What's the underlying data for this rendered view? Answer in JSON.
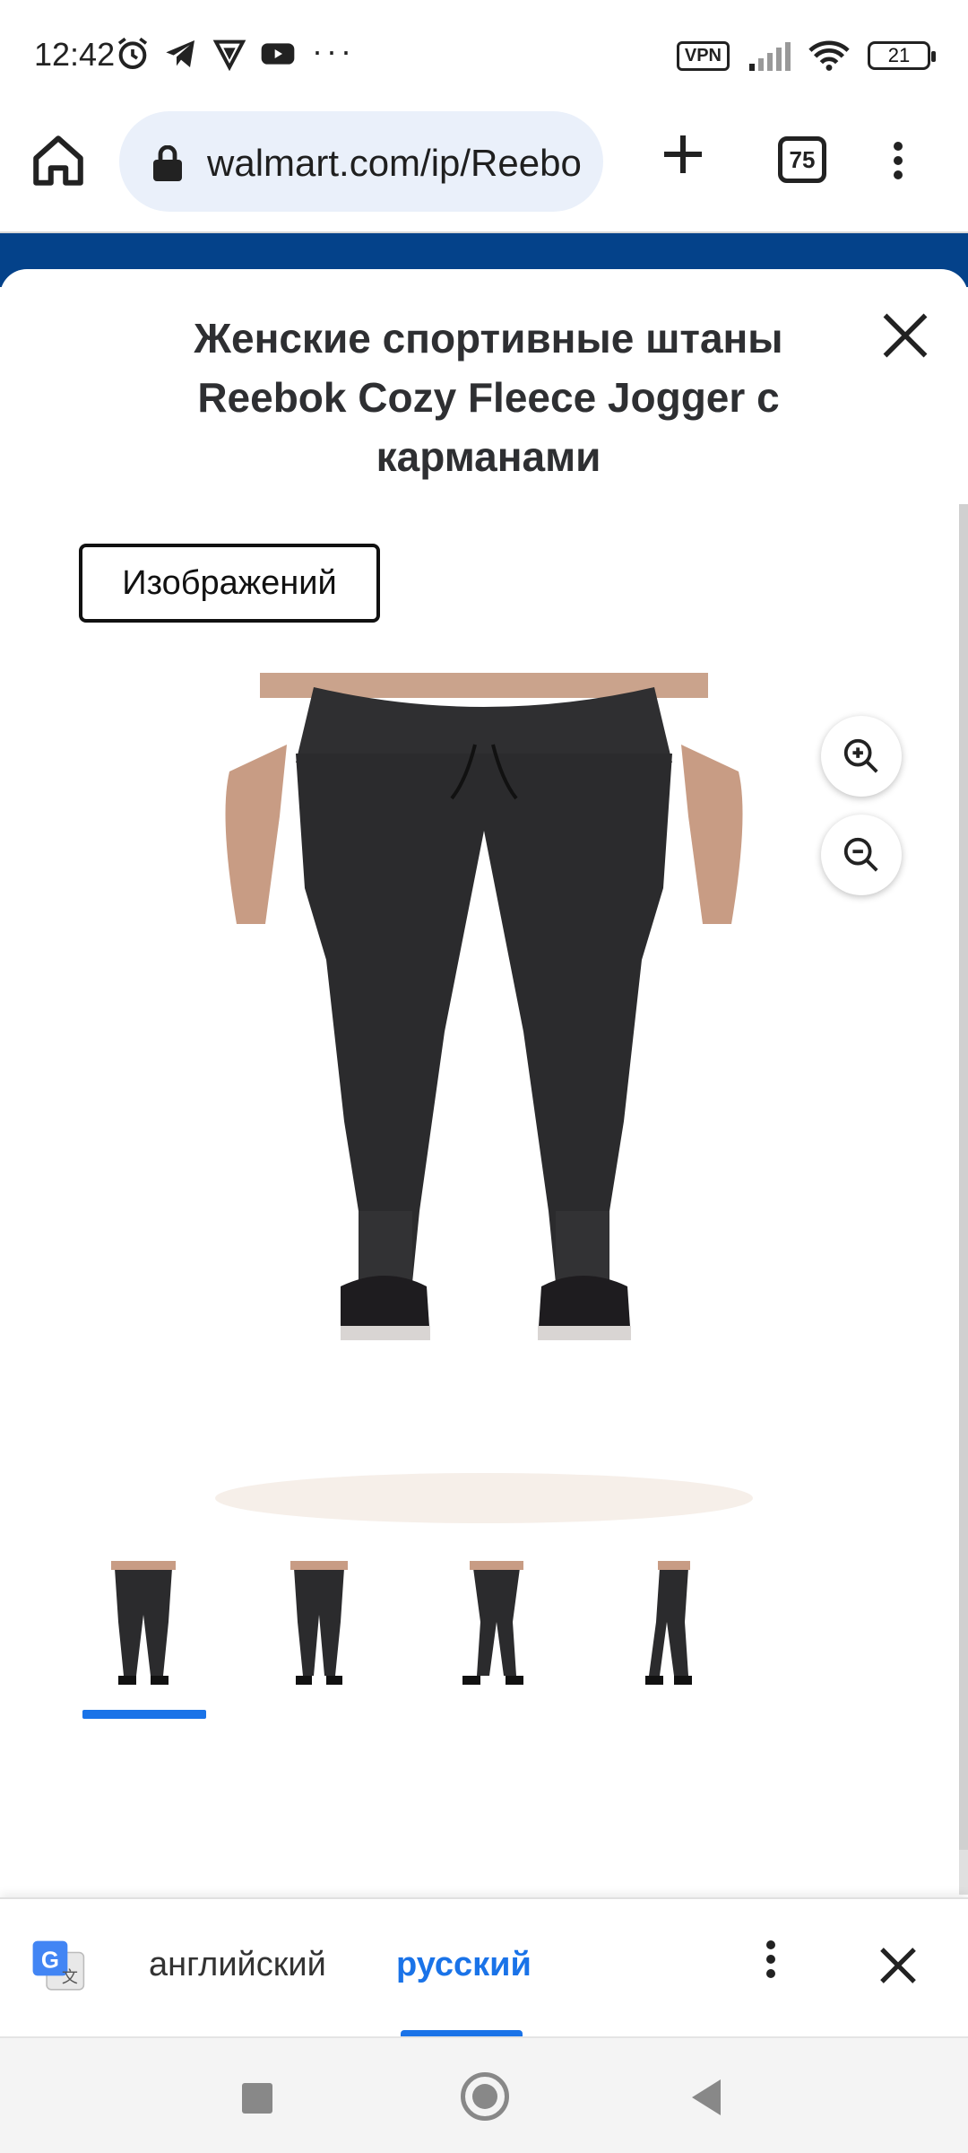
{
  "status_bar": {
    "time": "12:42",
    "vpn": "VPN",
    "battery": "21",
    "more": "···"
  },
  "browser": {
    "url": "walmart.com/ip/Reebok",
    "tab_count": "75"
  },
  "modal": {
    "title": "Женские спортивные штаны Reebok Cozy Fleece Jogger с карманами",
    "images_tab_label": "Изображений",
    "selected_thumbnail": 1,
    "thumbnail_count": 4
  },
  "translate_bar": {
    "source_language": "английский",
    "target_language": "русский"
  },
  "colors": {
    "accent": "#1a73e8",
    "site_header": "#04428a",
    "product_fabric": "#2b2b2d"
  }
}
